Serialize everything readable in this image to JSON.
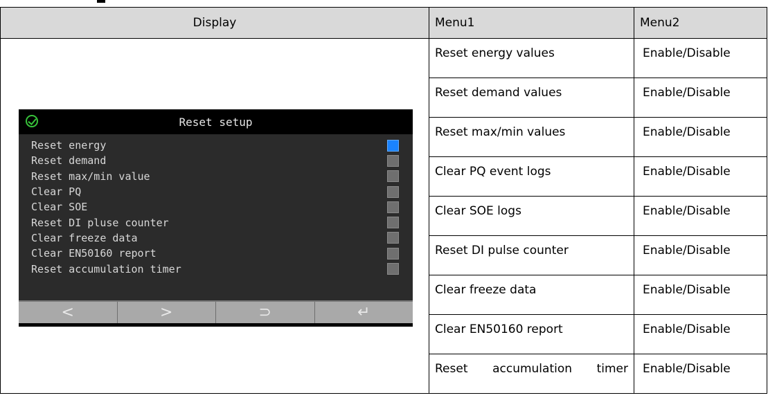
{
  "table": {
    "headers": {
      "display": "Display",
      "menu1": "Menu1",
      "menu2": "Menu2"
    },
    "rows": [
      {
        "menu1": "Reset energy values",
        "menu2": "Enable/Disable"
      },
      {
        "menu1": "Reset demand values",
        "menu2": "Enable/Disable"
      },
      {
        "menu1": "Reset max/min values",
        "menu2": "Enable/Disable"
      },
      {
        "menu1": "Clear PQ event logs",
        "menu2": "Enable/Disable"
      },
      {
        "menu1": "Clear SOE logs",
        "menu2": "Enable/Disable"
      },
      {
        "menu1": "Reset DI pulse counter",
        "menu2": "Enable/Disable"
      },
      {
        "menu1": "Clear freeze data",
        "menu2": "Enable/Disable"
      },
      {
        "menu1": "Clear EN50160 report",
        "menu2": "Enable/Disable"
      },
      {
        "menu1": "Reset accumulation timer",
        "menu2": "Enable/Disable"
      }
    ]
  },
  "device_screen": {
    "title": "Reset setup",
    "status_icon": "check-circle-icon",
    "status_color": "#37c23a",
    "selected_color": "#1a83ff",
    "items": [
      {
        "label": "Reset energy",
        "checked": true
      },
      {
        "label": "Reset demand",
        "checked": false
      },
      {
        "label": "Reset max/min value",
        "checked": false
      },
      {
        "label": "Clear PQ",
        "checked": false
      },
      {
        "label": "Clear SOE",
        "checked": false
      },
      {
        "label": "Reset DI pluse counter",
        "checked": false
      },
      {
        "label": "Clear freeze data",
        "checked": false
      },
      {
        "label": "Clear EN50160 report",
        "checked": false
      },
      {
        "label": "Reset accumulation timer",
        "checked": false
      }
    ],
    "buttons": [
      {
        "icon": "left-arrow-icon",
        "glyph": "<"
      },
      {
        "icon": "right-arrow-icon",
        "glyph": ">"
      },
      {
        "icon": "back-icon",
        "glyph": "⊃"
      },
      {
        "icon": "enter-icon",
        "glyph": "↵"
      }
    ]
  }
}
